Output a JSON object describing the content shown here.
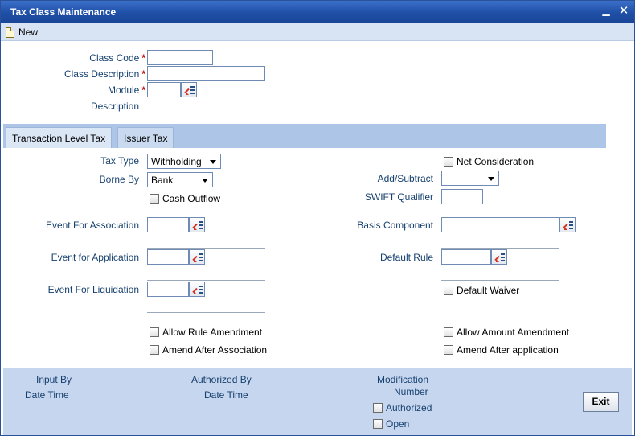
{
  "window": {
    "title": "Tax Class Maintenance",
    "minimize_glyph": "▁",
    "close_glyph": "✕"
  },
  "toolbar": {
    "new_label": "New"
  },
  "header_form": {
    "class_code_label": "Class Code",
    "class_code_value": "",
    "class_description_label": "Class Description",
    "class_description_value": "",
    "module_label": "Module",
    "module_value": "",
    "description_label": "Description",
    "description_value": "",
    "required_marker": "*"
  },
  "tabs": [
    {
      "label": "Transaction Level Tax",
      "active": true
    },
    {
      "label": "Issuer Tax",
      "active": false
    }
  ],
  "tax_form": {
    "tax_type_label": "Tax Type",
    "tax_type_value": "Withholding",
    "borne_by_label": "Borne By",
    "borne_by_value": "Bank",
    "cash_outflow_label": "Cash Outflow",
    "event_association_label": "Event For Association",
    "event_application_label": "Event for Application",
    "event_liquidation_label": "Event For Liquidation",
    "allow_rule_amendment_label": "Allow Rule Amendment",
    "amend_after_association_label": "Amend After Association",
    "net_consideration_label": "Net Consideration",
    "add_subtract_label": "Add/Subtract",
    "add_subtract_value": "",
    "swift_qualifier_label": "SWIFT Qualifier",
    "basis_component_label": "Basis Component",
    "default_rule_label": "Default Rule",
    "default_waiver_label": "Default Waiver",
    "allow_amount_amendment_label": "Allow Amount Amendment",
    "amend_after_application_label": "Amend After application"
  },
  "footer": {
    "input_by_label": "Input By",
    "date_time_label_1": "Date Time",
    "authorized_by_label": "Authorized By",
    "date_time_label_2": "Date Time",
    "modification_label": "Modification",
    "number_label": "Number",
    "authorized_label": "Authorized",
    "open_label": "Open",
    "exit_label": "Exit"
  },
  "colors": {
    "titlebar": "#1f4fa6",
    "label_text": "#16406f",
    "required": "#c00000",
    "panel": "#c6d6ee"
  },
  "icons": [
    "document-icon",
    "lov-list-icon",
    "dropdown-caret-icon",
    "minimize-icon",
    "close-icon"
  ]
}
